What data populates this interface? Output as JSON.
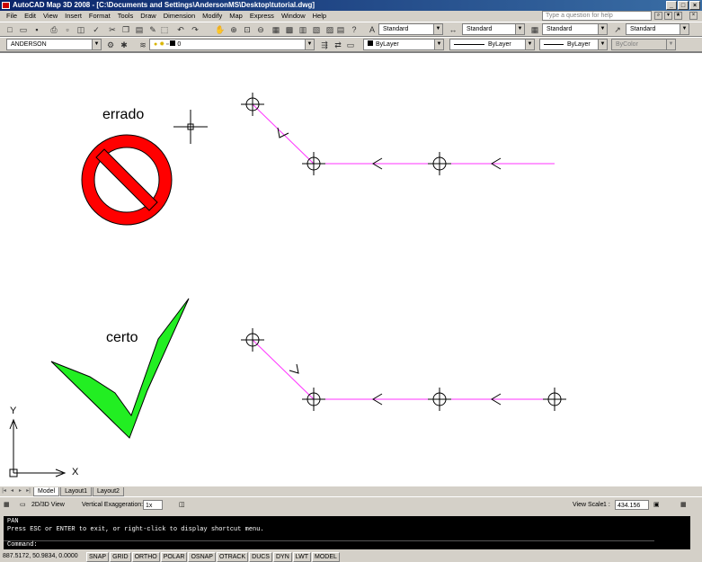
{
  "window": {
    "title": "AutoCAD Map 3D 2008 - [C:\\Documents and Settings\\AndersonMS\\Desktop\\tutorial.dwg]"
  },
  "menu": {
    "items": [
      "File",
      "Edit",
      "View",
      "Insert",
      "Format",
      "Tools",
      "Draw",
      "Dimension",
      "Modify",
      "Map",
      "Express",
      "Window",
      "Help"
    ],
    "help_placeholder": "Type a question for help"
  },
  "toolbar": {
    "text_style": "Standard",
    "dim_style": "Standard",
    "table_style": "Standard",
    "mleader_style": "Standard",
    "workspace": "ANDERSON",
    "layer": "0",
    "color": "ByLayer",
    "linetype": "ByLayer",
    "lineweight": "ByLayer",
    "plotstyle": "ByColor"
  },
  "drawing": {
    "label_wrong": "errado",
    "label_right": "certo",
    "ucs_x": "X",
    "ucs_y": "Y",
    "line_color": "#ff33ff",
    "wrong_color": "#ff0000",
    "right_color": "#22ee22"
  },
  "tabs": {
    "items": [
      "Model",
      "Layout1",
      "Layout2"
    ],
    "active": "Model"
  },
  "view_bar": {
    "mode": "2D/3D View",
    "vexag_label": "Vertical Exaggeration:",
    "vexag_value": "1x",
    "scale_label": "View Scale",
    "scale_value": "1 :",
    "scale_number": "434.156"
  },
  "command": {
    "lines": [
      "PAN",
      "Press ESC or ENTER to exit, or right-click to display shortcut menu."
    ],
    "prompt": "Command:"
  },
  "status": {
    "coords": "887.5172, 50.9834, 0.0000",
    "toggles": [
      "SNAP",
      "GRID",
      "ORTHO",
      "POLAR",
      "OSNAP",
      "OTRACK",
      "DUCS",
      "DYN",
      "LWT",
      "MODEL"
    ]
  }
}
